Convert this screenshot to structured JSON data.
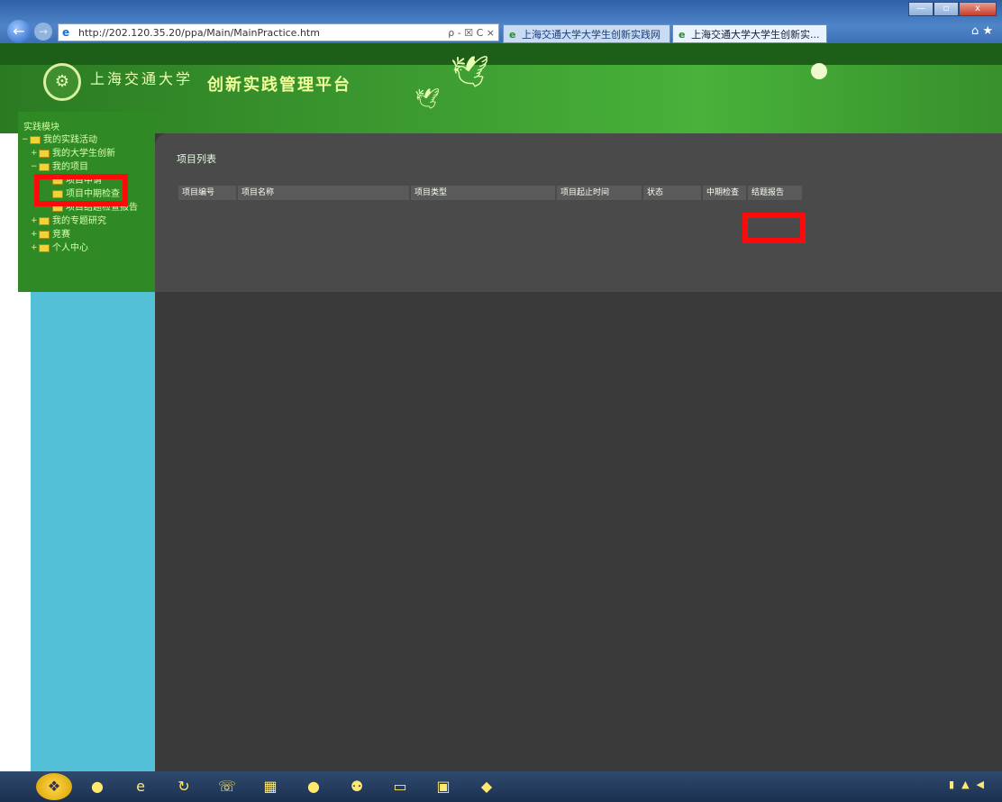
{
  "browser": {
    "address_url": "http://202.120.35.20/ppa/Main/MainPractice.htm",
    "address_tools": "ρ - ☒ C ×",
    "tabs": [
      {
        "label": "上海交通大学大学生创新实践网"
      },
      {
        "label": "上海交通大学大学生创新实...",
        "close": "×"
      }
    ],
    "window_buttons": [
      "—",
      "▫",
      "x"
    ],
    "right_icons": "⌂ ★"
  },
  "header": {
    "school_name": "上海交通大学",
    "platform_title": "创新实践管理平台"
  },
  "sidebar": {
    "title": "实践模块",
    "tree": [
      {
        "label": "我的实践活动"
      },
      {
        "label": "我的大学生创新"
      },
      {
        "label": "我的项目"
      },
      {
        "label": "项目申请"
      },
      {
        "label": "项目中期检查"
      },
      {
        "label": "项目结题检查报告"
      },
      {
        "label": "我的专题研究"
      },
      {
        "label": "竞赛"
      },
      {
        "label": "个人中心"
      }
    ]
  },
  "main": {
    "panel_title": "项目列表",
    "columns": [
      "项目编号",
      "项目名称",
      "项目类型",
      "项目起止时间",
      "状态",
      "中期检查",
      "结题报告"
    ]
  },
  "colors": {
    "highlight": "#ff0a0a"
  }
}
